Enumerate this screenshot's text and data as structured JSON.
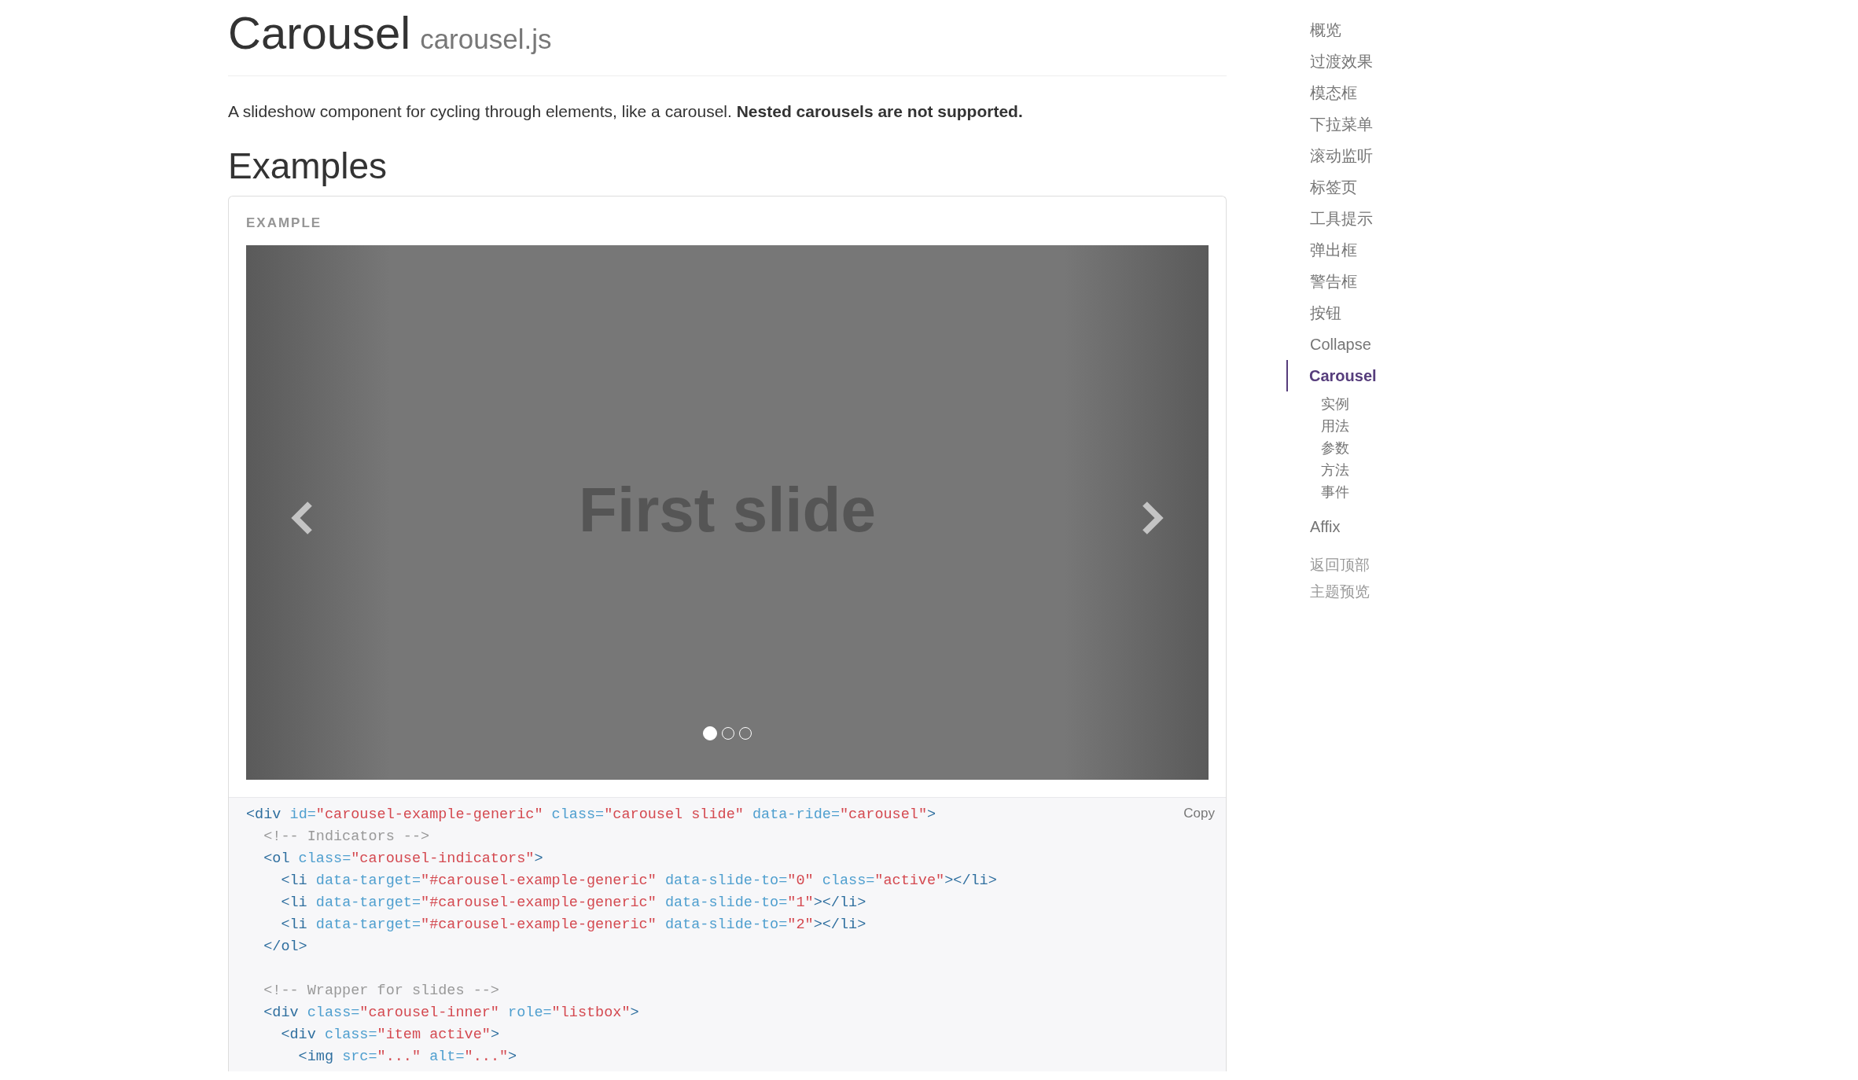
{
  "page": {
    "title": "Carousel",
    "subtitle": "carousel.js",
    "lead": "A slideshow component for cycling through elements, like a carousel. **Nested carousels are not supported.**",
    "section_heading": "Examples"
  },
  "example": {
    "label": "EXAMPLE",
    "slide_text": "First slide",
    "indicators": [
      {
        "selected": true
      },
      {
        "selected": false
      },
      {
        "selected": false
      }
    ],
    "copy_button": "Copy",
    "code_lines": [
      {
        "kind": "code",
        "tokens": [
          {
            "kind": "tag",
            "text": "<div"
          },
          {
            "kind": "attr",
            "text": " id="
          },
          {
            "kind": "str",
            "text": "\"carousel-example-generic\""
          },
          {
            "kind": "attr",
            "text": " class="
          },
          {
            "kind": "str",
            "text": "\"carousel slide\""
          },
          {
            "kind": "attr",
            "text": " data-ride="
          },
          {
            "kind": "str",
            "text": "\"carousel\""
          },
          {
            "kind": "tag",
            "text": ">"
          }
        ]
      },
      {
        "kind": "code",
        "tokens": [
          {
            "kind": "comment",
            "text": "  <!-- Indicators -->"
          }
        ]
      },
      {
        "kind": "code",
        "tokens": [
          {
            "kind": "tag",
            "text": "  <ol"
          },
          {
            "kind": "attr",
            "text": " class="
          },
          {
            "kind": "str",
            "text": "\"carousel-indicators\""
          },
          {
            "kind": "tag",
            "text": ">"
          }
        ]
      },
      {
        "kind": "code",
        "tokens": [
          {
            "kind": "tag",
            "text": "    <li"
          },
          {
            "kind": "attr",
            "text": " data-target="
          },
          {
            "kind": "str",
            "text": "\"#carousel-example-generic\""
          },
          {
            "kind": "attr",
            "text": " data-slide-to="
          },
          {
            "kind": "str",
            "text": "\"0\""
          },
          {
            "kind": "attr",
            "text": " class="
          },
          {
            "kind": "str",
            "text": "\"active\""
          },
          {
            "kind": "tag",
            "text": "></li>"
          }
        ]
      },
      {
        "kind": "code",
        "tokens": [
          {
            "kind": "tag",
            "text": "    <li"
          },
          {
            "kind": "attr",
            "text": " data-target="
          },
          {
            "kind": "str",
            "text": "\"#carousel-example-generic\""
          },
          {
            "kind": "attr",
            "text": " data-slide-to="
          },
          {
            "kind": "str",
            "text": "\"1\""
          },
          {
            "kind": "tag",
            "text": "></li>"
          }
        ]
      },
      {
        "kind": "code",
        "tokens": [
          {
            "kind": "tag",
            "text": "    <li"
          },
          {
            "kind": "attr",
            "text": " data-target="
          },
          {
            "kind": "str",
            "text": "\"#carousel-example-generic\""
          },
          {
            "kind": "attr",
            "text": " data-slide-to="
          },
          {
            "kind": "str",
            "text": "\"2\""
          },
          {
            "kind": "tag",
            "text": "></li>"
          }
        ]
      },
      {
        "kind": "code",
        "tokens": [
          {
            "kind": "tag",
            "text": "  </ol>"
          }
        ]
      },
      {
        "kind": "blank"
      },
      {
        "kind": "code",
        "tokens": [
          {
            "kind": "comment",
            "text": "  <!-- Wrapper for slides -->"
          }
        ]
      },
      {
        "kind": "code",
        "tokens": [
          {
            "kind": "tag",
            "text": "  <div"
          },
          {
            "kind": "attr",
            "text": " class="
          },
          {
            "kind": "str",
            "text": "\"carousel-inner\""
          },
          {
            "kind": "attr",
            "text": " role="
          },
          {
            "kind": "str",
            "text": "\"listbox\""
          },
          {
            "kind": "tag",
            "text": ">"
          }
        ]
      },
      {
        "kind": "code",
        "tokens": [
          {
            "kind": "tag",
            "text": "    <div"
          },
          {
            "kind": "attr",
            "text": " class="
          },
          {
            "kind": "str",
            "text": "\"item active\""
          },
          {
            "kind": "tag",
            "text": ">"
          }
        ]
      },
      {
        "kind": "code",
        "tokens": [
          {
            "kind": "tag",
            "text": "      <img"
          },
          {
            "kind": "attr",
            "text": " src="
          },
          {
            "kind": "str",
            "text": "\"...\""
          },
          {
            "kind": "attr",
            "text": " alt="
          },
          {
            "kind": "str",
            "text": "\"...\""
          },
          {
            "kind": "tag",
            "text": ">"
          }
        ]
      }
    ]
  },
  "sidebar": {
    "items": [
      {
        "kind": "section",
        "label": "概览",
        "selected": false
      },
      {
        "kind": "section",
        "label": "过渡效果",
        "selected": false
      },
      {
        "kind": "section",
        "label": "模态框",
        "selected": false
      },
      {
        "kind": "section",
        "label": "下拉菜单",
        "selected": false
      },
      {
        "kind": "section",
        "label": "滚动监听",
        "selected": false
      },
      {
        "kind": "section",
        "label": "标签页",
        "selected": false
      },
      {
        "kind": "section",
        "label": "工具提示",
        "selected": false
      },
      {
        "kind": "section",
        "label": "弹出框",
        "selected": false
      },
      {
        "kind": "section",
        "label": "警告框",
        "selected": false
      },
      {
        "kind": "section",
        "label": "按钮",
        "selected": false
      },
      {
        "kind": "section",
        "label": "Collapse",
        "selected": false
      },
      {
        "kind": "section",
        "label": "Carousel",
        "selected": true,
        "children": [
          {
            "label": "实例"
          },
          {
            "label": "用法"
          },
          {
            "label": "参数"
          },
          {
            "label": "方法"
          },
          {
            "label": "事件"
          }
        ]
      },
      {
        "kind": "section",
        "label": "Affix",
        "selected": false
      },
      {
        "kind": "utility",
        "label": "返回顶部"
      },
      {
        "kind": "utility",
        "label": "主题预览"
      }
    ]
  }
}
